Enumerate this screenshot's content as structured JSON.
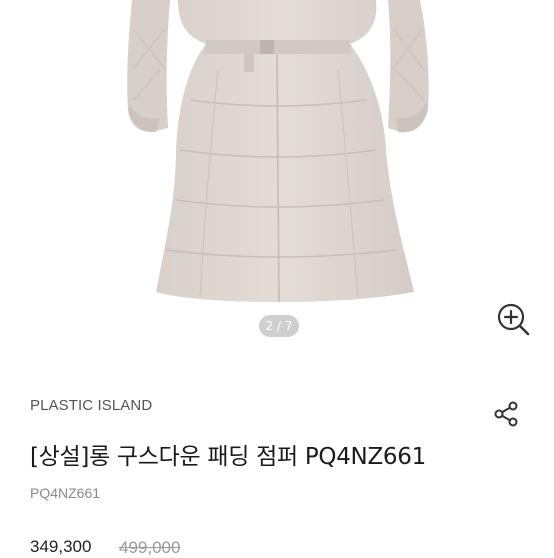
{
  "gallery": {
    "counter_text": "2 / 7",
    "image_alt": "long goose down padding coat"
  },
  "product": {
    "brand": "PLASTIC ISLAND",
    "title": "[상설]롱 구스다운 패딩 점퍼 PQ4NZ661",
    "model_code": "PQ4NZ661",
    "price": "349,300",
    "original_price": "499,000"
  },
  "icons": {
    "zoom": "zoom-in-icon",
    "share": "share-icon"
  },
  "colors": {
    "coat": "#ddd5cf",
    "text_primary": "#1b1b1b",
    "text_muted": "#8a8a8a"
  }
}
